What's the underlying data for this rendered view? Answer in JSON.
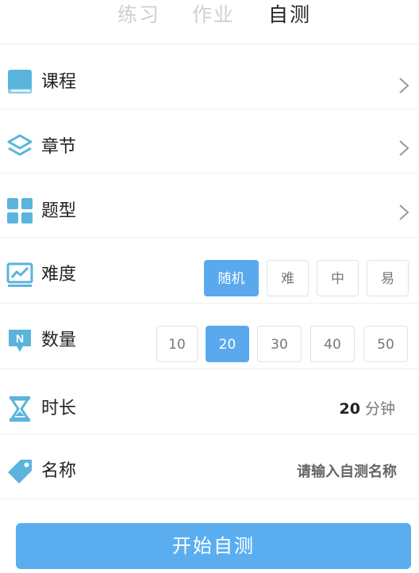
{
  "tabs": [
    {
      "label": "练习"
    },
    {
      "label": "作业"
    },
    {
      "label": "自测"
    }
  ],
  "rows": {
    "course": {
      "label": "课程",
      "icon": "book-icon"
    },
    "chapter": {
      "label": "章节",
      "icon": "layers-icon"
    },
    "question_type": {
      "label": "题型",
      "icon": "grid-icon"
    },
    "difficulty": {
      "label": "难度",
      "icon": "chart-icon",
      "options": [
        "随机",
        "难",
        "中",
        "易"
      ],
      "selected": "随机"
    },
    "quantity": {
      "label": "数量",
      "icon": "n-badge-icon",
      "icon_text": "N",
      "options": [
        "10",
        "20",
        "30",
        "40",
        "50"
      ],
      "selected": "20"
    },
    "duration": {
      "label": "时长",
      "icon": "hourglass-icon",
      "value": "20",
      "unit": "分钟"
    },
    "name": {
      "label": "名称",
      "icon": "tag-icon",
      "placeholder": "请输入自测名称"
    }
  },
  "start_button": {
    "label": "开始自测"
  },
  "colors": {
    "accent": "#5aa9ee",
    "icon": "#5ab4dc"
  }
}
